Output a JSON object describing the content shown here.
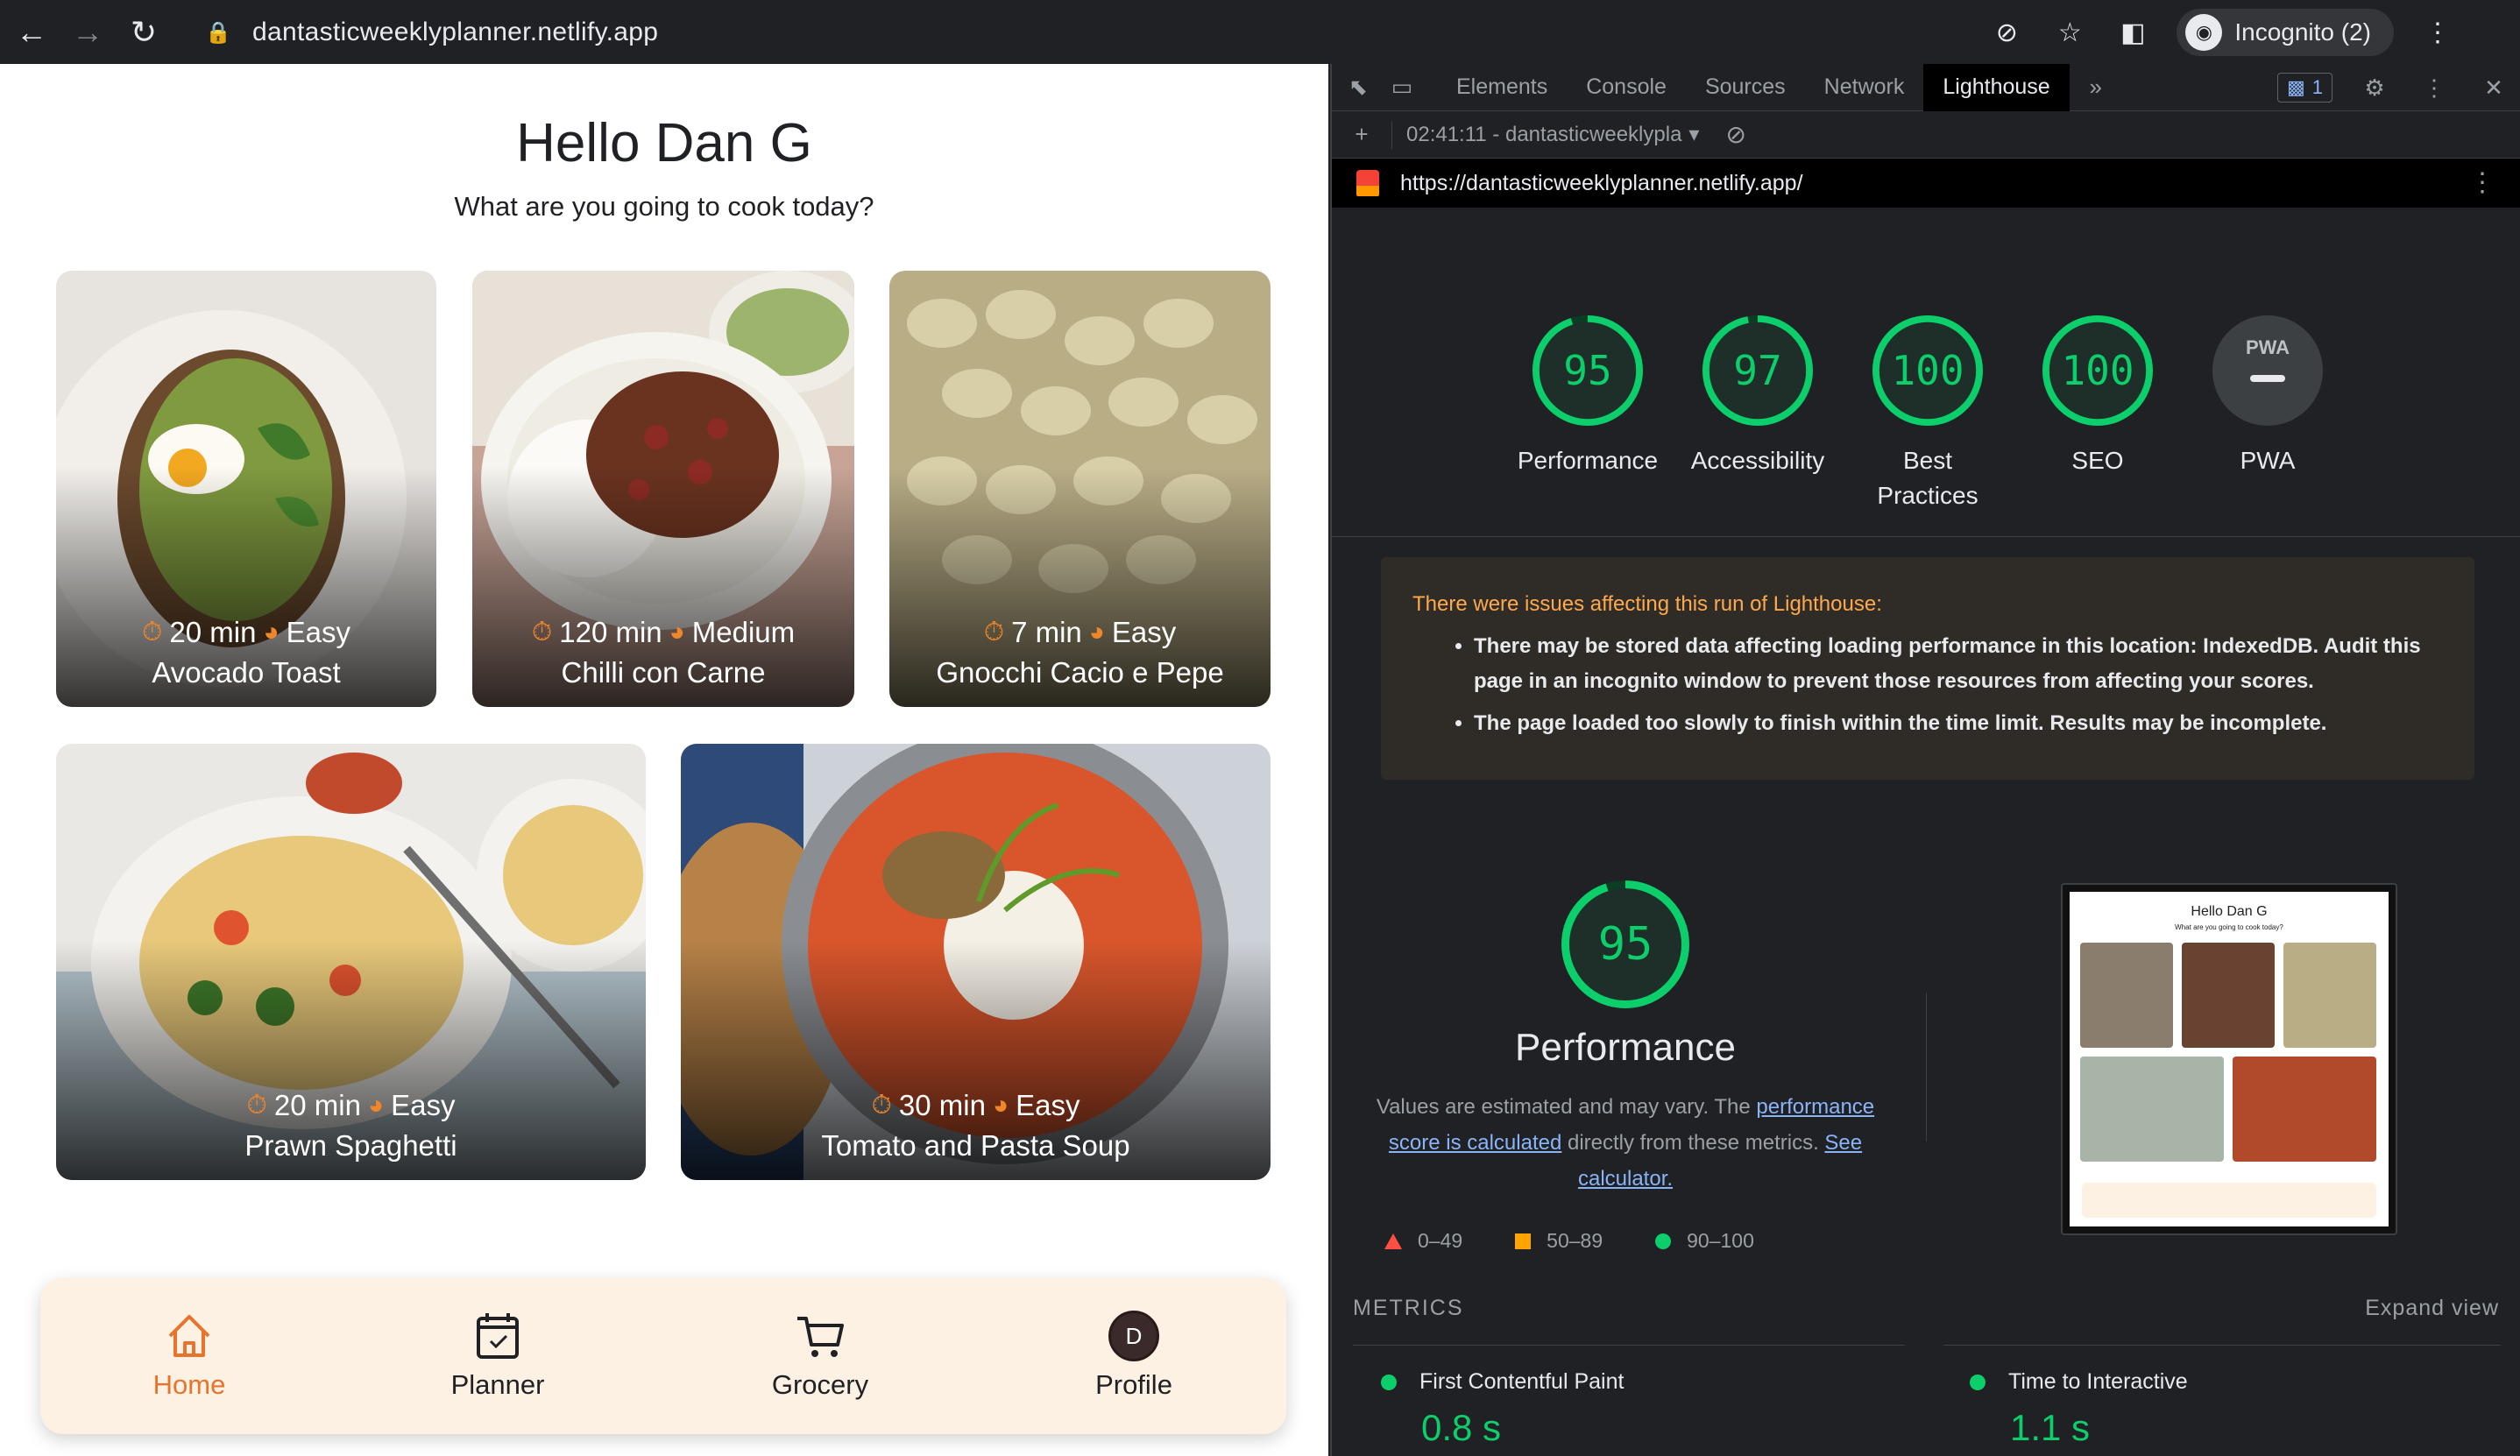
{
  "browser": {
    "url": "dantasticweeklyplanner.netlify.app",
    "incognito_label": "Incognito (2)",
    "icons": [
      "back-icon",
      "forward-icon",
      "reload-icon",
      "lock-icon",
      "eye-off-icon",
      "star-icon",
      "sidepanel-icon",
      "incognito-icon",
      "kebab-icon"
    ]
  },
  "app": {
    "greeting": "Hello Dan G",
    "subtitle": "What are you going to cook today?",
    "recipes": [
      {
        "time": "20 min",
        "difficulty": "Easy",
        "name": "Avocado Toast",
        "color": "#8a7d6e"
      },
      {
        "time": "120 min",
        "difficulty": "Medium",
        "name": "Chilli con Carne",
        "color": "#7a4a36"
      },
      {
        "time": "7 min",
        "difficulty": "Easy",
        "name": "Gnocchi Cacio e Pepe",
        "color": "#b9ad86"
      },
      {
        "time": "20 min",
        "difficulty": "Easy",
        "name": "Prawn Spaghetti",
        "color": "#a9b4a8"
      },
      {
        "time": "30 min",
        "difficulty": "Easy",
        "name": "Tomato and Pasta Soup",
        "color": "#b04a2a"
      }
    ],
    "nav": [
      {
        "label": "Home",
        "icon": "home-icon",
        "active": true
      },
      {
        "label": "Planner",
        "icon": "calendar-icon",
        "active": false
      },
      {
        "label": "Grocery",
        "icon": "cart-icon",
        "active": false
      },
      {
        "label": "Profile",
        "icon": "avatar",
        "active": false,
        "initial": "D"
      }
    ],
    "accent_color": "#e8732c"
  },
  "devtools": {
    "tabs": [
      "Elements",
      "Console",
      "Sources",
      "Network",
      "Lighthouse"
    ],
    "active_tab": "Lighthouse",
    "issues_count": "1",
    "report_label": "02:41:11 - dantasticweeklypla",
    "report_url": "https://dantasticweeklyplanner.netlify.app/",
    "scores": [
      {
        "value": "95",
        "label": "Performance",
        "fraction": 0.95
      },
      {
        "value": "97",
        "label": "Accessibility",
        "fraction": 0.97
      },
      {
        "value": "100",
        "label": "Best Practices",
        "fraction": 1.0
      },
      {
        "value": "100",
        "label": "SEO",
        "fraction": 1.0
      },
      {
        "value": "PWA",
        "label": "PWA",
        "fraction": 0
      }
    ],
    "warning": {
      "head": "There were issues affecting this run of Lighthouse:",
      "items": [
        "There may be stored data affecting loading performance in this location: IndexedDB. Audit this page in an incognito window to prevent those resources from affecting your scores.",
        "The page loaded too slowly to finish within the time limit. Results may be incomplete."
      ]
    },
    "performance": {
      "score": "95",
      "fraction": 0.95,
      "title": "Performance",
      "desc_1": "Values are estimated and may vary. The ",
      "link_1": "performance score is calculated",
      "desc_2": " directly from these metrics. ",
      "link_2": "See calculator.",
      "legend": [
        "0–49",
        "50–89",
        "90–100"
      ]
    },
    "thumbnail": {
      "greeting": "Hello Dan G",
      "subtitle": "What are you going to cook today?"
    },
    "metrics_head": "METRICS",
    "expand_view": "Expand view",
    "metrics": [
      {
        "label": "First Contentful Paint",
        "value": "0.8 s"
      },
      {
        "label": "Time to Interactive",
        "value": "1.1 s"
      }
    ],
    "green": "#0cce6b"
  }
}
